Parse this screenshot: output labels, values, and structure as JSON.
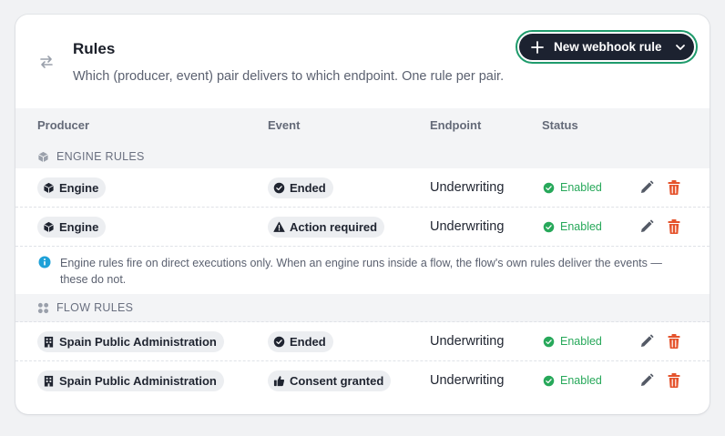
{
  "header": {
    "title": "Rules",
    "subtitle": "Which (producer, event) pair delivers to which endpoint. One rule per pair.",
    "new_button_label": "New webhook rule"
  },
  "columns": {
    "producer": "Producer",
    "event": "Event",
    "endpoint": "Endpoint",
    "status": "Status"
  },
  "sections": {
    "engine": {
      "label": "ENGINE RULES",
      "icon": "cube-icon"
    },
    "flow": {
      "label": "FLOW RULES",
      "icon": "dots-grid-icon"
    }
  },
  "engine_rows": [
    {
      "producer": "Engine",
      "producer_icon": "cube-icon",
      "event": "Ended",
      "event_icon": "check-circle-icon",
      "endpoint": "Underwriting",
      "status": "Enabled"
    },
    {
      "producer": "Engine",
      "producer_icon": "cube-icon",
      "event": "Action required",
      "event_icon": "warning-triangle-icon",
      "endpoint": "Underwriting",
      "status": "Enabled"
    }
  ],
  "info_note": "Engine rules fire on direct executions only. When an engine runs inside a flow, the flow's own rules deliver the events — these do not.",
  "flow_rows": [
    {
      "producer": "Spain Public Administration",
      "producer_icon": "building-icon",
      "event": "Ended",
      "event_icon": "check-circle-icon",
      "endpoint": "Underwriting",
      "status": "Enabled"
    },
    {
      "producer": "Spain Public Administration",
      "producer_icon": "building-icon",
      "event": "Consent granted",
      "event_icon": "thumbs-up-icon",
      "endpoint": "Underwriting",
      "status": "Enabled"
    }
  ],
  "colors": {
    "accent_ring": "#1f9b6c",
    "button_bg": "#1c2230",
    "status_enabled": "#27a85a",
    "delete": "#e5532c",
    "info": "#1ea1d8"
  }
}
